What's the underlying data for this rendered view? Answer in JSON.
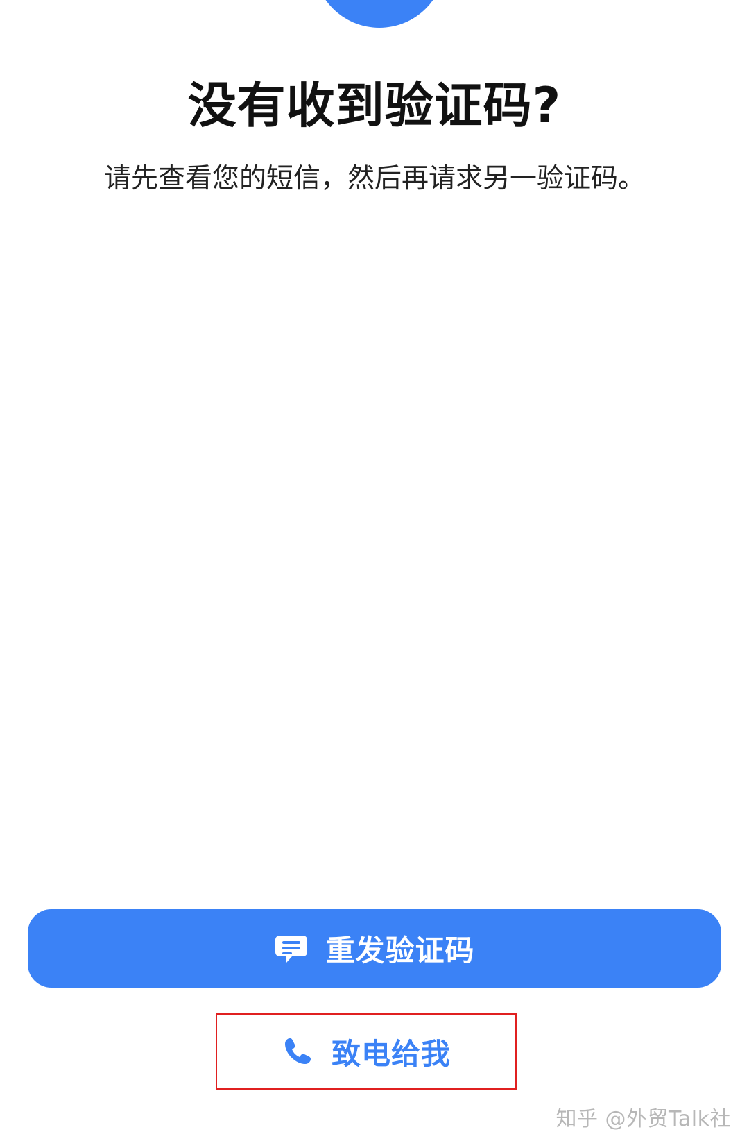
{
  "header": {
    "title": "没有收到验证码?",
    "subtitle": "请先查看您的短信，然后再请求另一验证码。"
  },
  "actions": {
    "resend": {
      "label": "重发验证码",
      "icon": "message-bubble-icon"
    },
    "call_me": {
      "label": "致电给我",
      "icon": "phone-icon"
    }
  },
  "watermark": {
    "text": "知乎 @外贸Talk社"
  },
  "colors": {
    "accent": "#3b82f6",
    "highlight_border": "#e02020"
  }
}
